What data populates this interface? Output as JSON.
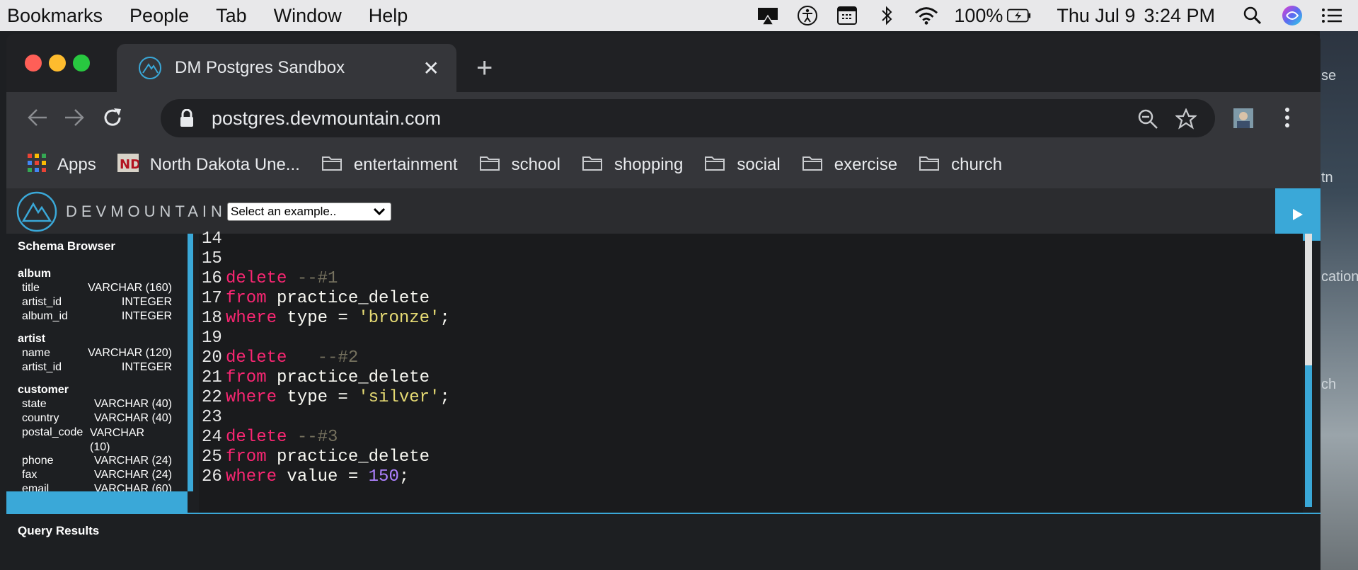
{
  "menubar": {
    "items": [
      "Bookmarks",
      "People",
      "Tab",
      "Window",
      "Help"
    ],
    "battery": "100%",
    "date": "Thu Jul 9",
    "time": "3:24 PM"
  },
  "browser": {
    "tab_title": "DM Postgres Sandbox",
    "url": "postgres.devmountain.com",
    "bookmarks": [
      "Apps",
      "North Dakota Une...",
      "entertainment",
      "school",
      "shopping",
      "social",
      "exercise",
      "church"
    ]
  },
  "wallpaper_text": [
    "se",
    "tn",
    "cation",
    "ch"
  ],
  "app": {
    "logo_text": "DEVMOUNTAIN",
    "example_select": "Select an example..",
    "accent": "#3aa8d8"
  },
  "schema": {
    "title": "Schema Browser",
    "tables": [
      {
        "name": "album",
        "columns": [
          {
            "name": "title",
            "type": "VARCHAR (160)"
          },
          {
            "name": "artist_id",
            "type": "INTEGER"
          },
          {
            "name": "album_id",
            "type": "INTEGER"
          }
        ]
      },
      {
        "name": "artist",
        "columns": [
          {
            "name": "name",
            "type": "VARCHAR (120)"
          },
          {
            "name": "artist_id",
            "type": "INTEGER"
          }
        ]
      },
      {
        "name": "customer",
        "columns": [
          {
            "name": "state",
            "type": "VARCHAR (40)"
          },
          {
            "name": "country",
            "type": "VARCHAR (40)"
          },
          {
            "name": "postal_code",
            "type": "VARCHAR (10)"
          },
          {
            "name": "phone",
            "type": "VARCHAR (24)"
          },
          {
            "name": "fax",
            "type": "VARCHAR (24)"
          },
          {
            "name": "email",
            "type": "VARCHAR (60)"
          }
        ]
      }
    ]
  },
  "editor": {
    "lines": [
      {
        "n": "14",
        "tokens": []
      },
      {
        "n": "15",
        "tokens": []
      },
      {
        "n": "16",
        "tokens": [
          [
            "kw",
            "delete"
          ],
          [
            "plain",
            " "
          ],
          [
            "cm",
            "--#1"
          ]
        ]
      },
      {
        "n": "17",
        "tokens": [
          [
            "kw",
            "from"
          ],
          [
            "plain",
            " practice_delete"
          ]
        ]
      },
      {
        "n": "18",
        "tokens": [
          [
            "kw",
            "where"
          ],
          [
            "plain",
            " type = "
          ],
          [
            "str",
            "'bronze'"
          ],
          [
            "plain",
            ";"
          ]
        ]
      },
      {
        "n": "19",
        "tokens": []
      },
      {
        "n": "20",
        "tokens": [
          [
            "kw",
            "delete"
          ],
          [
            "plain",
            "   "
          ],
          [
            "cm",
            "--#2"
          ]
        ]
      },
      {
        "n": "21",
        "tokens": [
          [
            "kw",
            "from"
          ],
          [
            "plain",
            " practice_delete"
          ]
        ]
      },
      {
        "n": "22",
        "tokens": [
          [
            "kw",
            "where"
          ],
          [
            "plain",
            " type = "
          ],
          [
            "str",
            "'silver'"
          ],
          [
            "plain",
            ";"
          ]
        ]
      },
      {
        "n": "23",
        "tokens": []
      },
      {
        "n": "24",
        "tokens": [
          [
            "kw",
            "delete"
          ],
          [
            "plain",
            " "
          ],
          [
            "cm",
            "--#3"
          ]
        ]
      },
      {
        "n": "25",
        "tokens": [
          [
            "kw",
            "from"
          ],
          [
            "plain",
            " practice_delete"
          ]
        ]
      },
      {
        "n": "26",
        "tokens": [
          [
            "kw",
            "where"
          ],
          [
            "plain",
            " value = "
          ],
          [
            "num",
            "150"
          ],
          [
            "plain",
            ";"
          ]
        ]
      }
    ]
  },
  "results": {
    "title": "Query Results"
  }
}
